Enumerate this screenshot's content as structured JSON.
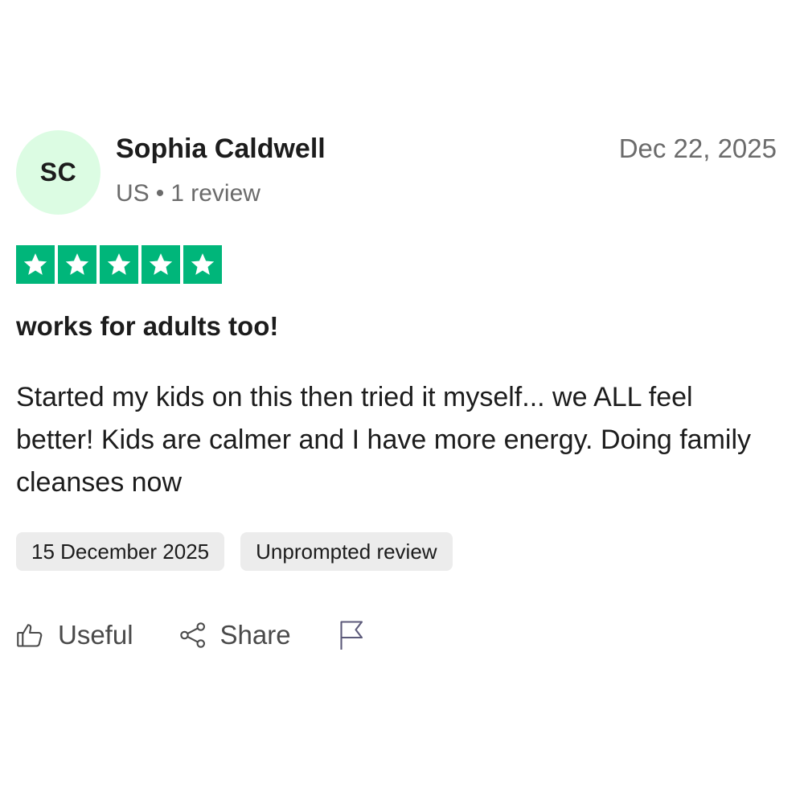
{
  "review": {
    "avatar_initials": "SC",
    "author_name": "Sophia Caldwell",
    "country": "US",
    "separator": "•",
    "review_count": "1 review",
    "date_posted": "Dec 22, 2025",
    "rating": 5,
    "rating_max": 5,
    "title": "works for adults too!",
    "body": "Started my kids on this then tried it myself... we ALL feel better! Kids are calmer and I have more energy. Doing family cleanses now",
    "tags": {
      "experience_date": "15 December 2025",
      "review_type": "Unprompted review"
    },
    "actions": {
      "useful_label": "Useful",
      "share_label": "Share"
    }
  },
  "icons": {
    "star": "star-icon",
    "useful": "thumbs-up-icon",
    "share": "share-icon",
    "report": "flag-icon"
  },
  "colors": {
    "star_green": "#00b67a",
    "avatar_bg": "#dcfce3",
    "tag_bg": "#ececec",
    "muted_text": "#6b6b6b"
  }
}
